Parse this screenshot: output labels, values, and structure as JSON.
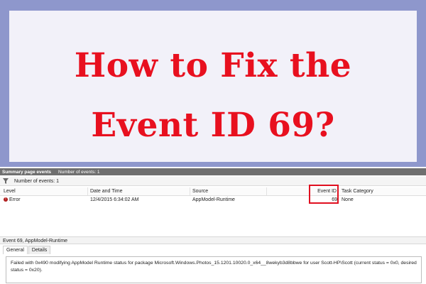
{
  "banner": {
    "line1": "How to Fix the",
    "line2": "Event ID 69?"
  },
  "summary": {
    "title": "Summary page events",
    "count": "Number of events: 1"
  },
  "filter": {
    "icon": "filter-icon",
    "text": "Number of events: 1"
  },
  "table": {
    "columns": [
      "Level",
      "Date and Time",
      "Source",
      "Event ID",
      "Task Category"
    ],
    "rows": [
      {
        "level": "Error",
        "date_time": "12/4/2015 6:34:02 AM",
        "source": "AppModel-Runtime",
        "event_id": "69",
        "task_category": "None"
      }
    ]
  },
  "detail": {
    "title": "Event 69, AppModel-Runtime",
    "tabs": [
      "General",
      "Details"
    ],
    "message": "Failed with 0x490 modifying AppModel Runtime status for package Microsoft.Windows.Photos_15.1201.10020.0_x64__8wekyb3d8bbwe for user Scott-HP\\Scott (current status = 0x0, desired status = 0x20)."
  },
  "colors": {
    "headline": "#e8101f",
    "highlight_box": "#e01020",
    "frame": "#8e97cc"
  }
}
